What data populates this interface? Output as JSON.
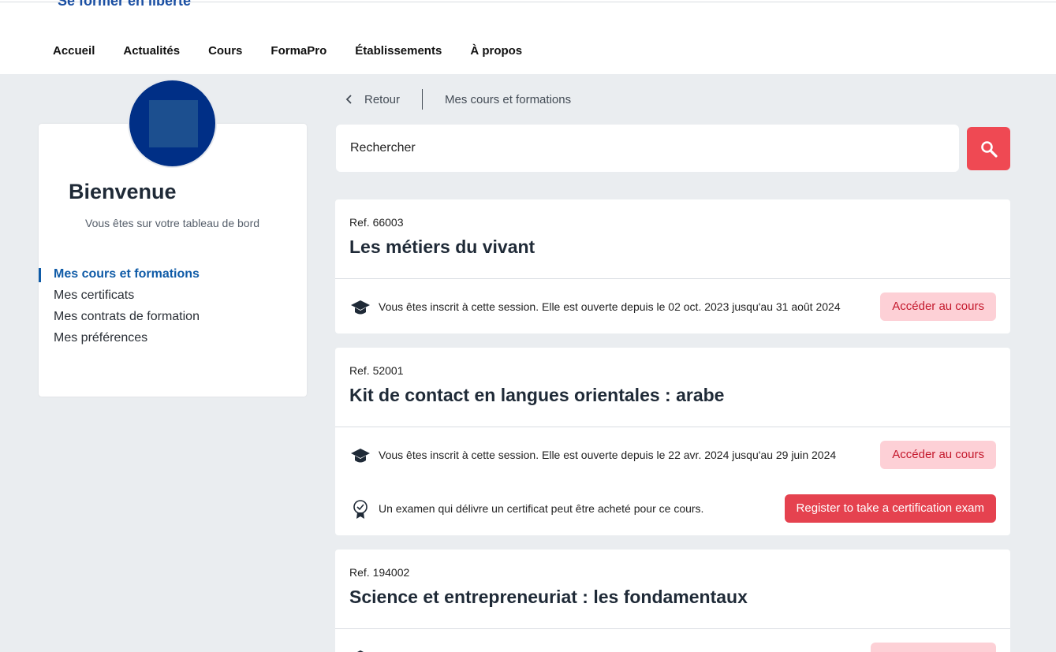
{
  "header": {
    "tagline": "Se former en liberté",
    "nav": [
      "Accueil",
      "Actualités",
      "Cours",
      "FormaPro",
      "Établissements",
      "À propos"
    ]
  },
  "sidebar": {
    "welcome": "Bienvenue",
    "subtitle": "Vous êtes sur votre tableau de bord",
    "menu": [
      "Mes cours et formations",
      "Mes certificats",
      "Mes contrats de formation",
      "Mes préférences"
    ]
  },
  "breadcrumb": {
    "back": "Retour",
    "current": "Mes cours et formations"
  },
  "search": {
    "placeholder": "Rechercher"
  },
  "courses": [
    {
      "ref": "Ref. 66003",
      "title": "Les métiers du vivant",
      "session": "Vous êtes inscrit à cette session. Elle est ouverte depuis le 02 oct. 2023 jusqu'au 31 août 2024",
      "access_label": "Accéder au cours"
    },
    {
      "ref": "Ref. 52001",
      "title": "Kit de contact en langues orientales : arabe",
      "session": "Vous êtes inscrit à cette session. Elle est ouverte depuis le 22 avr. 2024 jusqu'au 29 juin 2024",
      "access_label": "Accéder au cours",
      "exam_text": "Un examen qui délivre un certificat peut être acheté pour ce cours.",
      "exam_label": "Register to take a certification exam"
    },
    {
      "ref": "Ref. 194002",
      "title": "Science et entrepreneuriat : les fondamentaux"
    }
  ],
  "colors": {
    "brand_blue": "#0f5ba7",
    "accent_red": "#ef4953",
    "access_bg": "#fdd0d6"
  }
}
